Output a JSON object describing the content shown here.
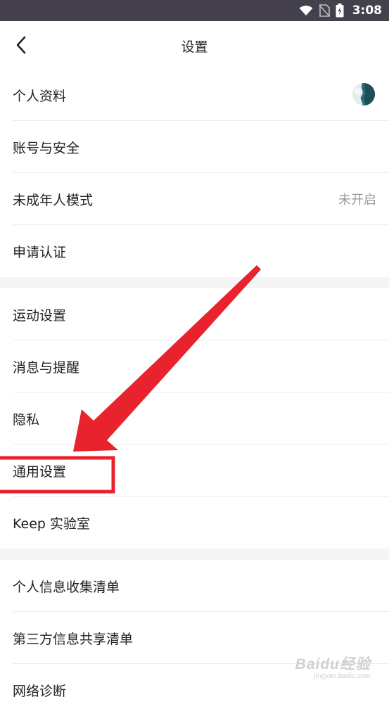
{
  "status_bar": {
    "time": "3:08",
    "icons": [
      "wifi-icon",
      "no-sim-icon",
      "battery-charging-icon"
    ]
  },
  "header": {
    "title": "设置",
    "back_icon": "chevron-left-icon"
  },
  "sections": [
    {
      "items": [
        {
          "label": "个人资料",
          "trailing": "avatar"
        },
        {
          "label": "账号与安全"
        },
        {
          "label": "未成年人模式",
          "value": "未开启"
        },
        {
          "label": "申请认证"
        }
      ]
    },
    {
      "items": [
        {
          "label": "运动设置"
        },
        {
          "label": "消息与提醒"
        },
        {
          "label": "隐私"
        },
        {
          "label": "通用设置",
          "highlighted": true
        },
        {
          "label": "Keep 实验室"
        }
      ]
    },
    {
      "items": [
        {
          "label": "个人信息收集清单"
        },
        {
          "label": "第三方信息共享清单"
        },
        {
          "label": "网络诊断"
        }
      ]
    }
  ],
  "annotation": {
    "color": "#e8232d",
    "shapes": [
      "arrow",
      "highlight-box"
    ]
  },
  "watermark": {
    "logo": "Baidu经验",
    "url": "jingyan.baidu.com"
  },
  "colors": {
    "status_bar_bg": "#45404d",
    "section_gap_bg": "#f5f5f6",
    "value_text": "#9a9a9a",
    "accent_annotation": "#e8232d"
  }
}
